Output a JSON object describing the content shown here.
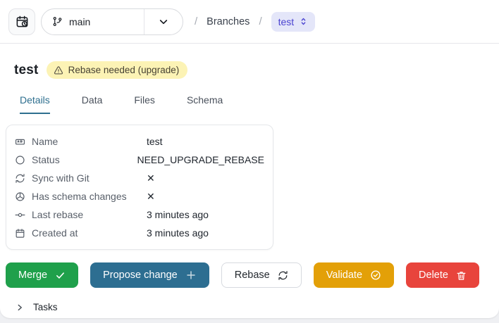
{
  "topbar": {
    "history_button_icon": "calendar-clock-icon",
    "branch_select": {
      "value": "main",
      "icon": "git-branch-icon"
    },
    "breadcrumb": {
      "separator": "/",
      "section": "Branches",
      "current_branch": "test"
    }
  },
  "page": {
    "title": "test",
    "warning_badge": {
      "label": "Rebase needed (upgrade)",
      "bg": "#fcf3b5",
      "icon": "warning-triangle-icon"
    }
  },
  "tabs": [
    {
      "label": "Details",
      "active": true
    },
    {
      "label": "Data",
      "active": false
    },
    {
      "label": "Files",
      "active": false
    },
    {
      "label": "Schema",
      "active": false
    }
  ],
  "details": {
    "rows": [
      {
        "icon": "name-badge-icon",
        "label": "Name",
        "value": "test"
      },
      {
        "icon": "status-circle-icon",
        "label": "Status",
        "value": "NEED_UPGRADE_REBASE"
      },
      {
        "icon": "sync-arrows-icon",
        "label": "Sync with Git",
        "value": "✕"
      },
      {
        "icon": "sphere-icon",
        "label": "Has schema changes",
        "value": "✕"
      },
      {
        "icon": "commit-icon",
        "label": "Last rebase",
        "value": "3 minutes ago"
      },
      {
        "icon": "calendar-icon",
        "label": "Created at",
        "value": "3 minutes ago"
      }
    ]
  },
  "actions": [
    {
      "label": "Merge",
      "icon": "check-icon",
      "color": "#1fa04b"
    },
    {
      "label": "Propose change",
      "icon": "plus-icon",
      "color": "#2d6e91"
    },
    {
      "label": "Rebase",
      "icon": "refresh-icon",
      "color": "#ffffff"
    },
    {
      "label": "Validate",
      "icon": "badge-check-icon",
      "color": "#e3a008"
    },
    {
      "label": "Delete",
      "icon": "trash-icon",
      "color": "#e8443c"
    }
  ],
  "tasks": {
    "label": "Tasks",
    "icon": "chevron-right-icon"
  },
  "colors": {
    "active_tab": "#2e6f8f",
    "breadcrumb_select_bg": "#e4e6f9",
    "breadcrumb_select_text": "#4a43d0",
    "page_background": "#eff0f3"
  }
}
